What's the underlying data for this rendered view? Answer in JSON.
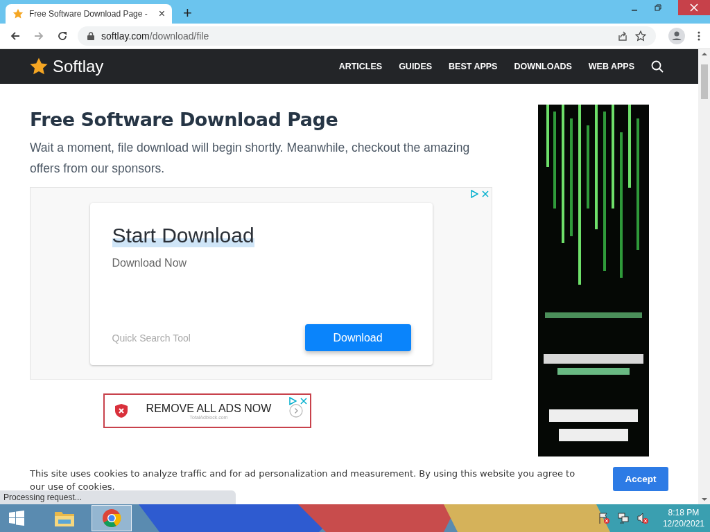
{
  "browser": {
    "tab": {
      "title": "Free Software Download Page -",
      "close": "×",
      "selected": true
    },
    "new_tab": "+",
    "url_host": "softlay.com",
    "url_path": "/download/file"
  },
  "site": {
    "logo": "Softlay",
    "nav": [
      "ARTICLES",
      "GUIDES",
      "BEST APPS",
      "DOWNLOADS",
      "WEB APPS"
    ]
  },
  "page": {
    "heading": "Free Software Download Page",
    "intro": "Wait a moment, file download will begin shortly. Meanwhile, checkout the amazing offers from our sponsors.",
    "ad": {
      "title": "Start Download",
      "subtitle": "Download Now",
      "source": "Quick Search Tool",
      "button": "Download"
    },
    "banner": {
      "text": "REMOVE ALL ADS NOW",
      "source": "TotalAdblock.com"
    }
  },
  "cookie_bar": {
    "text": "This site uses cookies to analyze traffic and for ad personalization and measurement. By using this website you agree to our use of cookies.",
    "button": "Accept"
  },
  "status_bubble": "Processing request...",
  "taskbar": {
    "apps": [
      {
        "kind": "folder",
        "selected": false
      },
      {
        "kind": "chrome",
        "selected": true
      }
    ],
    "time": "8:18 PM",
    "date": "12/20/2021"
  }
}
